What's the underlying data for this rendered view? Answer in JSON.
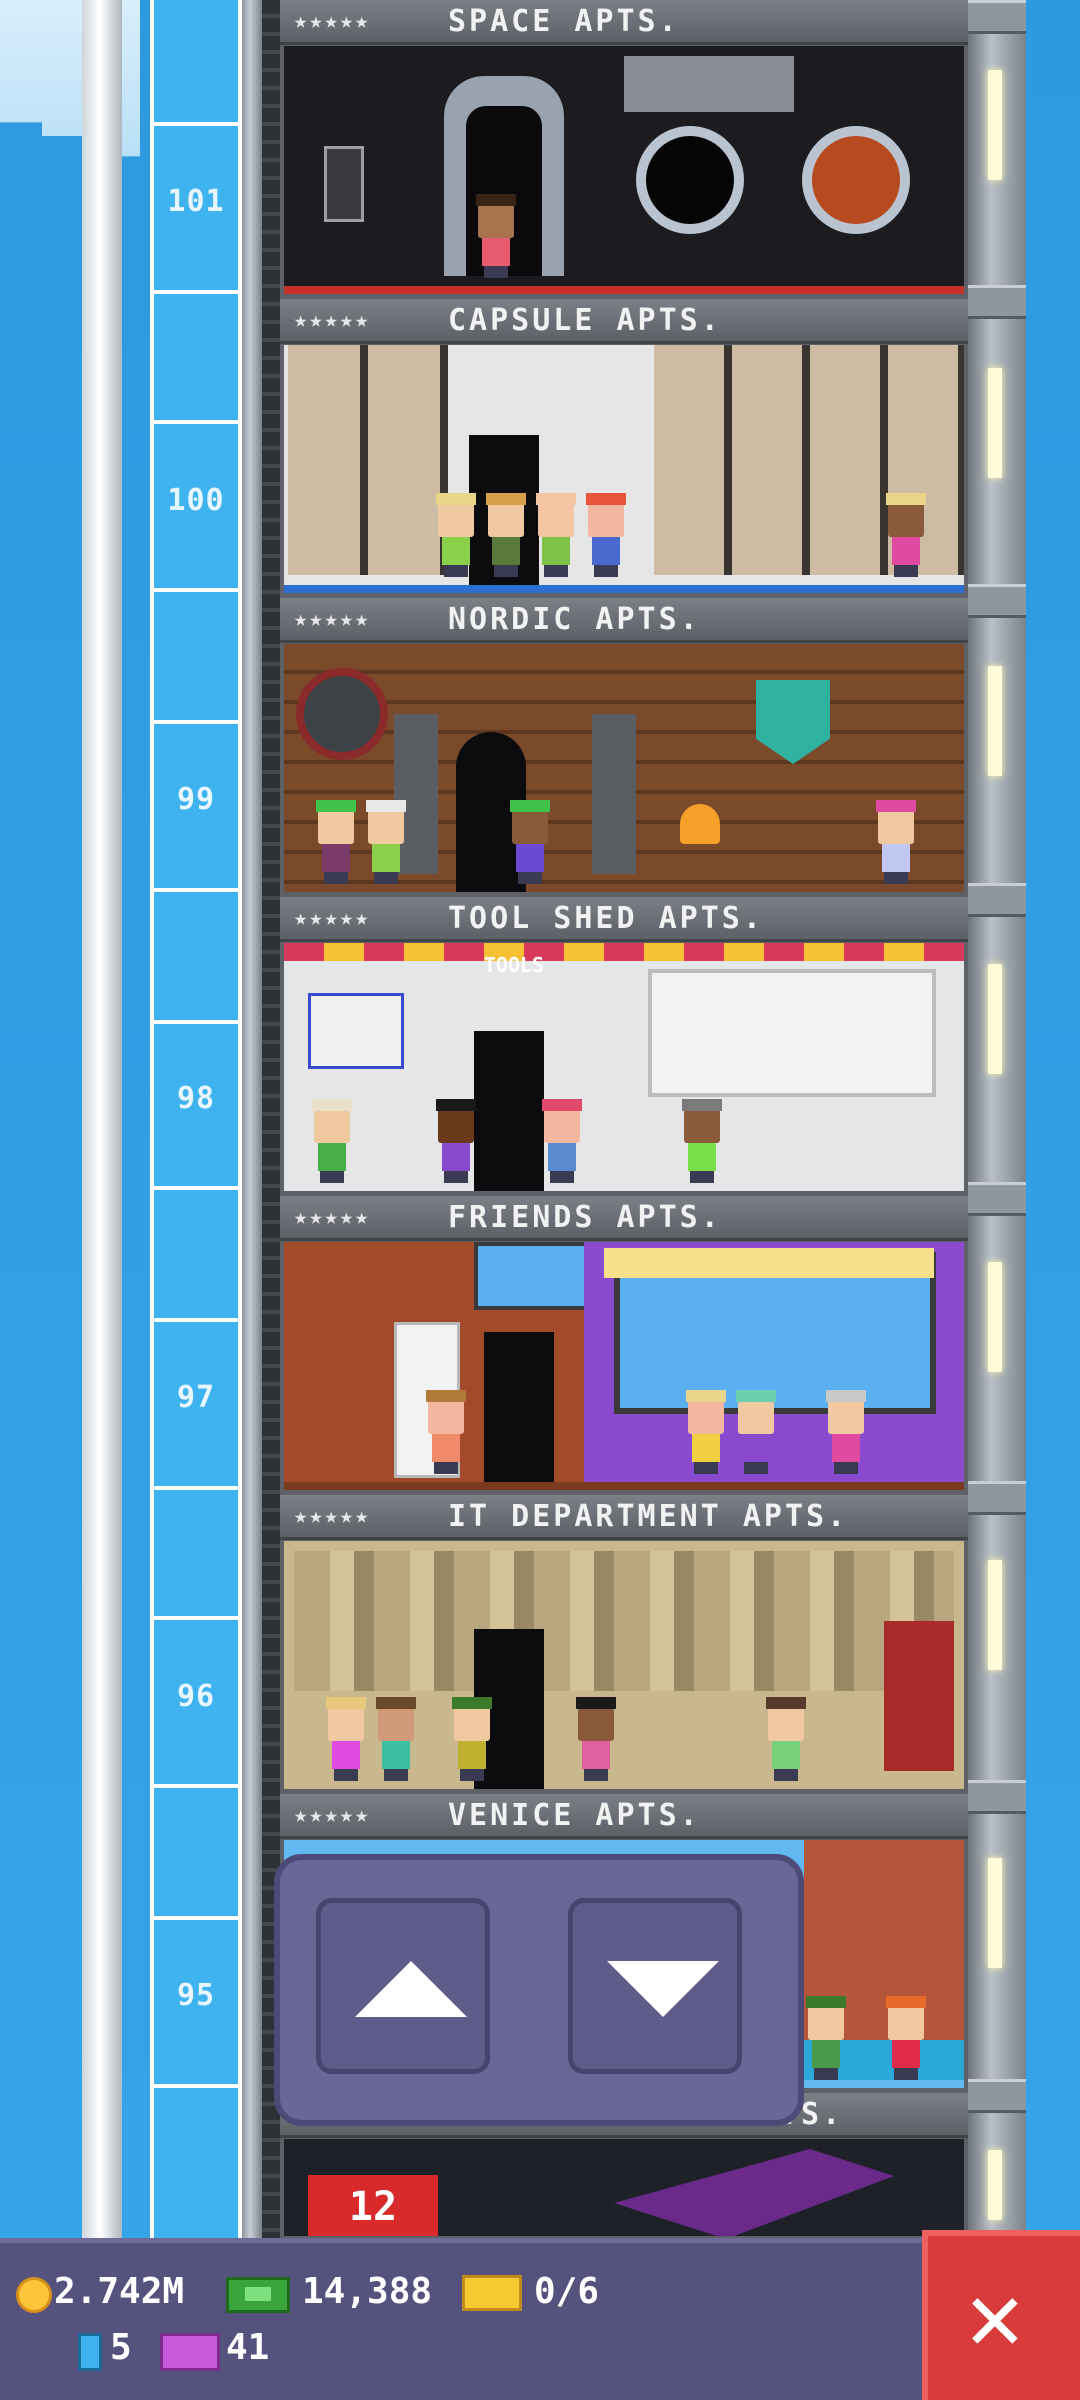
{
  "shaft": {
    "floor_numbers": [
      "101",
      "100",
      "99",
      "98",
      "97",
      "96",
      "95"
    ]
  },
  "floors": [
    {
      "name": "SPACE APTS.",
      "stars": "★★★★★"
    },
    {
      "name": "CAPSULE APTS.",
      "stars": "★★★★★"
    },
    {
      "name": "NORDIC APTS.",
      "stars": "★★★★★"
    },
    {
      "name": "TOOL SHED APTS.",
      "stars": "★★★★★"
    },
    {
      "name": "FRIENDS APTS.",
      "stars": "★★★★★"
    },
    {
      "name": "IT DEPARTMENT APTS.",
      "stars": "★★★★★"
    },
    {
      "name": "VENICE APTS.",
      "stars": "★★★★★"
    },
    {
      "name": "TS.",
      "stars": ""
    }
  ],
  "decor": {
    "tool_sign": "TOOLS",
    "bottom_display": "12"
  },
  "controls": {
    "up_icon": "arrow-up-icon",
    "down_icon": "arrow-down-icon"
  },
  "status": {
    "coins": "2.742M",
    "bux": "14,388",
    "tickets": "0/6",
    "keys": "5",
    "vip": "41"
  },
  "colors": {
    "sky": "#2f9de0",
    "panel": "#55527e",
    "close": "#d93a3a"
  }
}
